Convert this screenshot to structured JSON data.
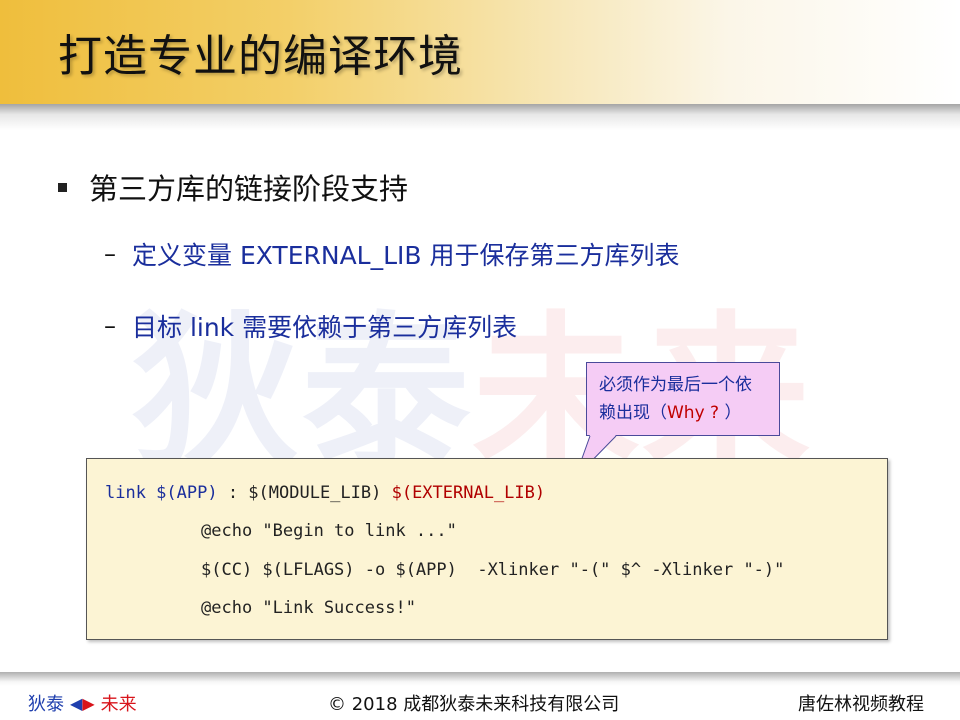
{
  "slide": {
    "title": "打造专业的编译环境",
    "watermark": {
      "part1": "狄泰",
      "part2": "未来"
    },
    "bullet": "第三方库的链接阶段支持",
    "sub_bullets": [
      {
        "dash": "–",
        "text": "定义变量 EXTERNAL_LIB 用于保存第三方库列表"
      },
      {
        "dash": "–",
        "text": "目标 link 需要依赖于第三方库列表"
      }
    ],
    "callout": {
      "line1": "必须作为最后一个依",
      "line2_prefix": "赖出现（",
      "line2_why": "Why ?",
      "line2_suffix": " ）"
    },
    "code": {
      "line1_a": "link $(APP)",
      "line1_b": " : $(MODULE_LIB) ",
      "line1_c": "$(EXTERNAL_LIB)",
      "line2": "@echo \"Begin to link ...\"",
      "line3": "$(CC) $(LFLAGS) -o $(APP)  -Xlinker \"-(\" $^ -Xlinker \"-)\"",
      "line4": "@echo \"Link Success!\""
    }
  },
  "footer": {
    "left_a": "狄泰",
    "left_b": "未来",
    "center": "© 2018 成都狄泰未来科技有限公司",
    "right": "唐佐林视频教程"
  },
  "colors": {
    "accent_blue": "#1a2e9c",
    "accent_red": "#b00000",
    "header_gold": "#efbe3c",
    "code_bg": "#fcf4d4",
    "callout_bg": "#f5ccf5"
  },
  "icons": {
    "footer_arrows": "left-right-arrows-icon",
    "bullet": "square-bullet-icon"
  }
}
